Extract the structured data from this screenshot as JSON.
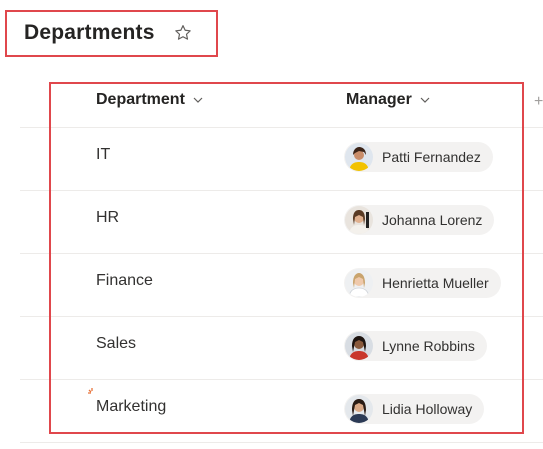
{
  "header": {
    "title": "Departments"
  },
  "columns": {
    "department": "Department",
    "manager": "Manager",
    "add": "+"
  },
  "rows": [
    {
      "department": "IT",
      "manager": "Patti Fernandez"
    },
    {
      "department": "HR",
      "manager": "Johanna Lorenz"
    },
    {
      "department": "Finance",
      "manager": "Henrietta Mueller"
    },
    {
      "department": "Sales",
      "manager": "Lynne Robbins"
    },
    {
      "department": "Marketing",
      "manager": "Lidia Holloway"
    }
  ],
  "colors": {
    "highlight": "#e0474c",
    "persona_bg": "#f3f2f1",
    "new_marker": "#e8733a"
  },
  "icons": {
    "favorite": "star-outline-icon",
    "sort": "chevron-down-icon",
    "new_item": "new-item-burst-icon"
  }
}
